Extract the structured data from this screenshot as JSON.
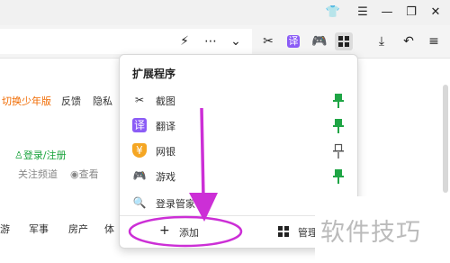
{
  "window": {
    "controls": [
      {
        "name": "shirt-icon",
        "glyph": "👕"
      },
      {
        "name": "menu-icon",
        "glyph": "☰"
      },
      {
        "name": "minimize-icon",
        "glyph": "—"
      },
      {
        "name": "restore-icon",
        "glyph": "❐"
      },
      {
        "name": "close-icon",
        "glyph": "✕"
      }
    ]
  },
  "toolbar": {
    "icons": [
      {
        "name": "lightning-icon",
        "glyph": "⚡"
      },
      {
        "name": "more-icon",
        "glyph": "⋯"
      },
      {
        "name": "chevron-down-icon",
        "glyph": "⌄"
      },
      {
        "name": "scissors-icon",
        "glyph": "✂"
      },
      {
        "name": "translate-ext-icon",
        "glyph": "译"
      },
      {
        "name": "game-ext-icon",
        "glyph": "🎮"
      },
      {
        "name": "extensions-icon",
        "glyph": "▦"
      },
      {
        "name": "download-icon",
        "glyph": "⤓"
      },
      {
        "name": "undo-icon",
        "glyph": "↶"
      },
      {
        "name": "menu-icon",
        "glyph": "≡"
      }
    ]
  },
  "page": {
    "nav": {
      "switch_youth": "切换少年版",
      "feedback": "反馈",
      "privacy": "隐私"
    },
    "login": "登录/注册",
    "follow": "关注频道",
    "look": "查看",
    "categories": [
      "游",
      "军事",
      "房产",
      "体"
    ]
  },
  "popup": {
    "title": "扩展程序",
    "items": [
      {
        "label": "截图",
        "icon": "scissors-icon",
        "glyph": "✂",
        "pinned": true
      },
      {
        "label": "翻译",
        "icon": "translate-icon",
        "glyph": "译",
        "pinned": true
      },
      {
        "label": "网银",
        "icon": "shield-icon",
        "glyph": "¥",
        "pinned": false
      },
      {
        "label": "游戏",
        "icon": "gamepad-icon",
        "glyph": "🎮",
        "pinned": true
      },
      {
        "label": "登录管家",
        "icon": "key-search-icon",
        "glyph": "🔍",
        "pinned": false
      }
    ],
    "add_label": "添加",
    "manage_label": "管理"
  },
  "colors": {
    "accent_green": "#19a33b",
    "accent_orange": "#f06a00",
    "annotation_magenta": "#cc2fd6",
    "pin_green": "#1fa545"
  },
  "watermark": "软件技巧"
}
